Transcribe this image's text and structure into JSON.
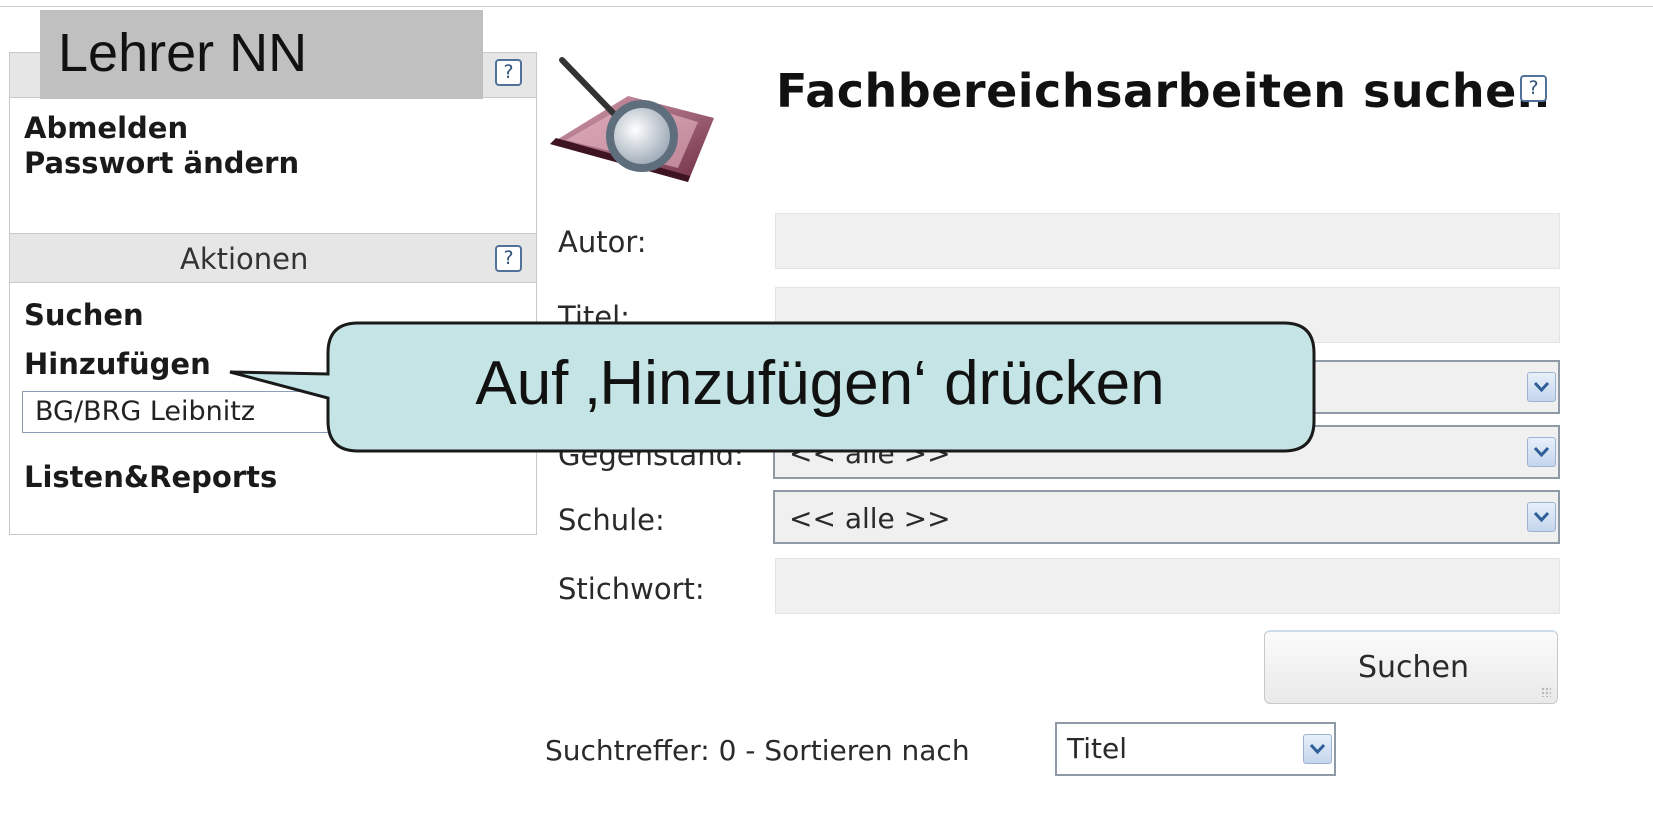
{
  "header": {
    "user_name": "Lehrer NN",
    "help_symbol": "?"
  },
  "user_menu": {
    "logout": "Abmelden",
    "change_password": "Passwort ändern"
  },
  "actions": {
    "title": "Aktionen",
    "search": "Suchen",
    "add": "Hinzufügen",
    "school_selected": "BG/BRG Leibnitz",
    "lists_reports": "Listen&Reports"
  },
  "page": {
    "title": "Fachbereichsarbeiten suchen",
    "icon": "book-magnifier-icon"
  },
  "form": {
    "author_label": "Autor:",
    "author_value": "",
    "title_label": "Titel:",
    "title_value": "",
    "subject_label": "Gegenstand:",
    "subject_value": "<< alle >>",
    "school_label": "Schule:",
    "school_value": "<< alle >>",
    "keyword_label": "Stichwort:",
    "keyword_value": "",
    "search_button": "Suchen"
  },
  "results": {
    "text": "Suchtreffer: 0 - Sortieren nach",
    "sort_value": "Titel"
  },
  "callout": {
    "text": "Auf ‚Hinzufügen‘ drücken"
  },
  "colors": {
    "callout_fill": "#c5e4e5",
    "label_box": "#c0c0c0",
    "panel_header": "#e6e6e6",
    "field_bg": "#f0f0f0"
  }
}
